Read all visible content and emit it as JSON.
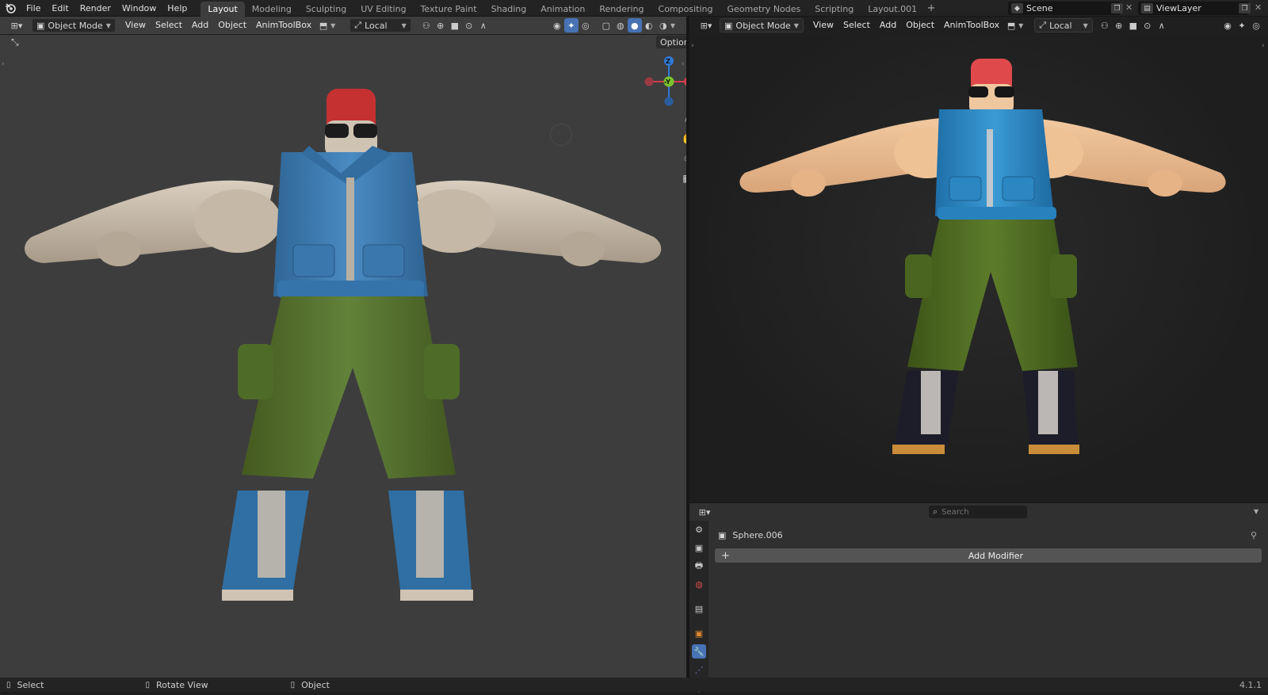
{
  "app": {
    "logo_icon": "blender-logo-icon"
  },
  "menu": [
    "File",
    "Edit",
    "Render",
    "Window",
    "Help"
  ],
  "workspaces": [
    "Layout",
    "Modeling",
    "Sculpting",
    "UV Editing",
    "Texture Paint",
    "Shading",
    "Animation",
    "Rendering",
    "Compositing",
    "Geometry Nodes",
    "Scripting",
    "Layout.001"
  ],
  "active_workspace": "Layout",
  "add_workspace": "+",
  "scene": {
    "label": "Scene"
  },
  "view_layer": {
    "label": "ViewLayer"
  },
  "viewport_left": {
    "mode": "Object Mode",
    "menus": [
      "View",
      "Select",
      "Add",
      "Object",
      "AnimToolBox"
    ],
    "transform_orientation": "Local",
    "options_label": "Options",
    "gizmo": {
      "z": "Z",
      "y": "-Y",
      "x": "X"
    }
  },
  "viewport_right": {
    "mode": "Object Mode",
    "menus": [
      "View",
      "Select",
      "Add",
      "Object",
      "AnimToolBox"
    ],
    "transform_orientation": "Local"
  },
  "properties": {
    "search_placeholder": "Search",
    "object_name": "Sphere.006",
    "add_modifier": "Add Modifier",
    "add_modifier_plus": "+"
  },
  "status_bar": {
    "select": "Select",
    "rotate": "Rotate View",
    "object": "Object",
    "version": "4.1.1"
  },
  "colors": {
    "accent": "#4772b3",
    "jacket_blue_left": "#3e7ab0",
    "pants_green_left": "#56712f",
    "hair_red": "#c93232",
    "skin_left": "#c9bba9",
    "jacket_blue_right": "#2f86c0",
    "pants_green_right": "#4e6a22",
    "skin_right": "#e8b98f"
  }
}
